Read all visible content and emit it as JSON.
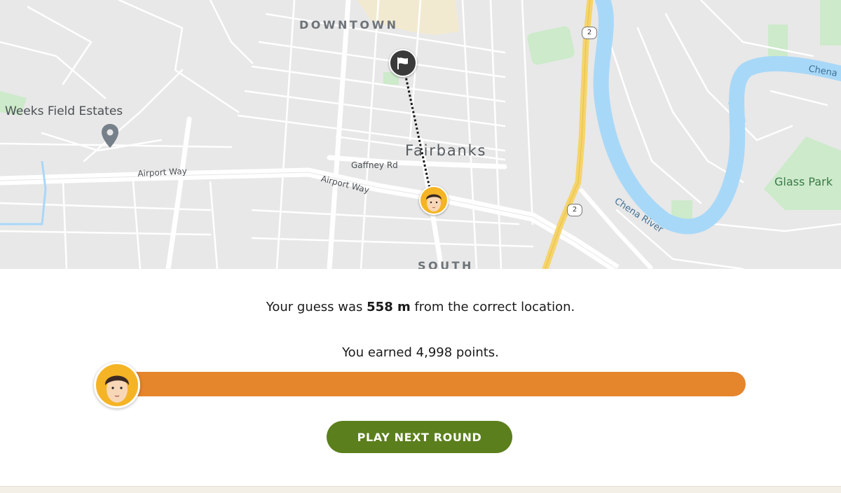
{
  "map": {
    "labels": {
      "downtown": "DOWNTOWN",
      "south": "SOUTH",
      "fairbanks": "Fairbanks",
      "weeks_field_estates": "Weeks Field Estates",
      "gaffney_rd": "Gaffney Rd",
      "airport_way_west": "Airport Way",
      "airport_way_east": "Airport Way",
      "chena_river": "Chena River",
      "chena": "Chena",
      "glass_park": "Glass Park"
    },
    "highway_shields": [
      "2",
      "2"
    ],
    "colors": {
      "land": "#e8e8e8",
      "road": "#ffffff",
      "highway": "#f6d46b",
      "water": "#a8d8f8",
      "park": "#cdeacb"
    },
    "markers": {
      "correct_location_icon": "flag-icon",
      "guess_icon": "player-face-icon",
      "poi_icon": "location-pin-icon"
    }
  },
  "result": {
    "distance_prefix": "Your guess was ",
    "distance_value": "558 m",
    "distance_suffix": " from the correct location.",
    "points_text": "You earned 4,998 points.",
    "points_earned": 4998,
    "points_max": 5000,
    "progress_fraction": 0.9996,
    "progress_color": "#e5852c",
    "next_round_label": "PLAY NEXT ROUND",
    "button_color": "#5b7f1c"
  }
}
